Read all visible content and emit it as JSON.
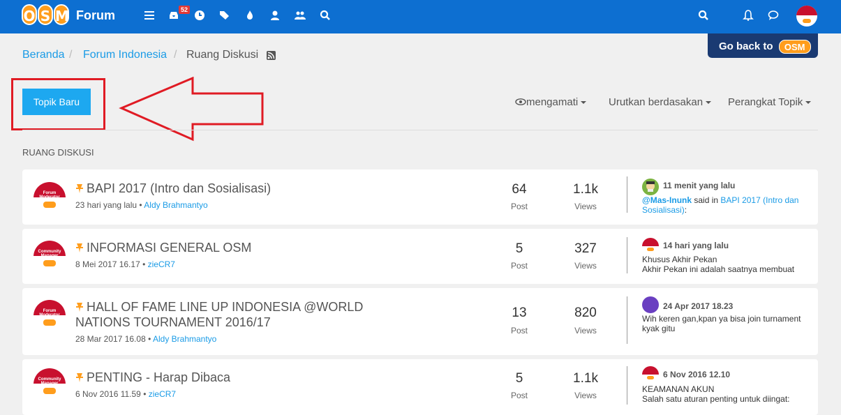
{
  "navbar": {
    "logo_letters": [
      "O",
      "S",
      "M"
    ],
    "brand": "Forum",
    "notification_count": "52",
    "icons": [
      "list-icon",
      "inbox-icon",
      "clock-icon",
      "tags-icon",
      "fire-icon",
      "user-icon",
      "users-icon",
      "search-icon",
      "search-icon",
      "bell-icon",
      "chat-icon"
    ]
  },
  "goback": {
    "label": "Go back to",
    "logo": "OSM"
  },
  "breadcrumb": {
    "items": [
      "Beranda",
      "Forum Indonesia"
    ],
    "separator": "/",
    "current": "Ruang Diskusi"
  },
  "toolbar": {
    "new_topic": "Topik Baru",
    "watch": "mengamati",
    "sort": "Urutkan berdasakan",
    "tools": "Perangkat Topik"
  },
  "section": {
    "title": "RUANG DISKUSI"
  },
  "topics": [
    {
      "title": "BAPI 2017 (Intro dan Sosialisasi)",
      "time": "23 hari yang lalu",
      "author": "Aldy Brahmantyo",
      "avatar_line1": "Forum",
      "avatar_line2": "Moderator",
      "posts": "64",
      "posts_label": "Post",
      "views": "1.1k",
      "views_label": "Views",
      "last_time": "11 menit yang lalu",
      "last_user": "@Mas-Inunk",
      "last_said": " said in ",
      "last_link": "BAPI 2017 (Intro dan Sosialisasi)",
      "last_end": ":"
    },
    {
      "title": "INFORMASI GENERAL OSM",
      "time": "8 Mei 2017 16.17",
      "author": "zieCR7",
      "avatar_line1": "Community",
      "avatar_line2": "Manager",
      "posts": "5",
      "posts_label": "Post",
      "views": "327",
      "views_label": "Views",
      "last_time": "14 hari yang lalu",
      "last_line1": "Khusus Akhir Pekan",
      "last_line2": "Akhir Pekan ini adalah saatnya membuat"
    },
    {
      "title": "HALL OF FAME LINE UP INDONESIA @WORLD NATIONS TOURNAMENT 2016/17",
      "time": "28 Mar 2017 16.08",
      "author": "Aldy Brahmantyo",
      "avatar_line1": "Forum",
      "avatar_line2": "Moderator",
      "posts": "13",
      "posts_label": "Post",
      "views": "820",
      "views_label": "Views",
      "last_time": "24 Apr 2017 18.23",
      "last_line1": "Wih keren gan,kpan ya bisa join turnament kyak gitu"
    },
    {
      "title": "PENTING - Harap Dibaca",
      "time": "6 Nov 2016 11.59",
      "author": "zieCR7",
      "avatar_line1": "Community",
      "avatar_line2": "Manager",
      "posts": "5",
      "posts_label": "Post",
      "views": "1.1k",
      "views_label": "Views",
      "last_time": "6 Nov 2016 12.10",
      "last_line1": "KEAMANAN AKUN",
      "last_line2": "Salah satu aturan penting untuk diingat:"
    }
  ],
  "colors": {
    "navbar": "#0d6fd1",
    "accent": "#1da8f0",
    "link": "#1a9be6",
    "pin": "#ff9d1c",
    "annotation": "#e01b24"
  }
}
